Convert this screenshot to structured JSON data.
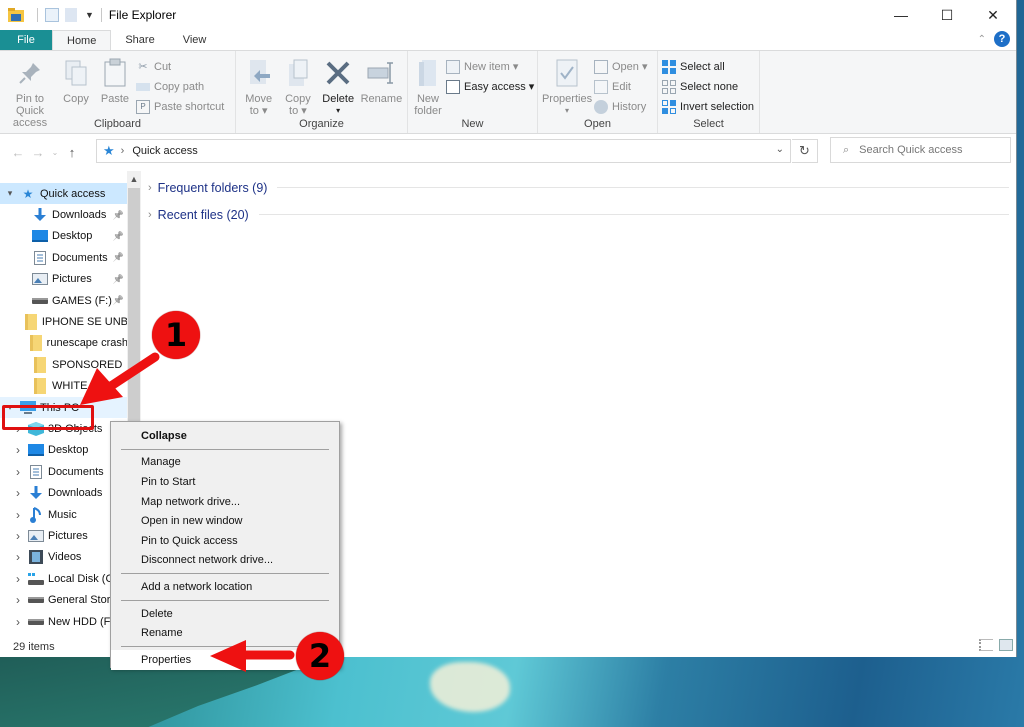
{
  "window": {
    "title": "File Explorer",
    "controls": {
      "minimize": "—",
      "maximize": "☐",
      "close": "✕"
    }
  },
  "tabs": [
    {
      "label": "File",
      "active": false
    },
    {
      "label": "Home",
      "active": true
    },
    {
      "label": "Share",
      "active": false
    },
    {
      "label": "View",
      "active": false
    }
  ],
  "ribbon": {
    "clipboard": {
      "label": "Clipboard",
      "pin": "Pin to Quick access",
      "pin_line1": "Pin to Quick",
      "pin_line2": "access",
      "copy": "Copy",
      "paste": "Paste",
      "cut": "Cut",
      "copy_path": "Copy path",
      "paste_shortcut": "Paste shortcut"
    },
    "organize": {
      "label": "Organize",
      "move_line1": "Move",
      "move_line2": "to ▾",
      "copy_line1": "Copy",
      "copy_line2": "to ▾",
      "delete": "Delete",
      "delete_dd": "▾",
      "rename": "Rename"
    },
    "new": {
      "label": "New",
      "new_folder_line1": "New",
      "new_folder_line2": "folder",
      "new_item": "New item ▾",
      "easy_access": "Easy access ▾"
    },
    "open": {
      "label": "Open",
      "properties": "Properties",
      "properties_dd": "▾",
      "open": "Open ▾",
      "edit": "Edit",
      "history": "History"
    },
    "select": {
      "label": "Select",
      "select_all": "Select all",
      "select_none": "Select none",
      "invert": "Invert selection"
    }
  },
  "navigation": {
    "address_path": "Quick access",
    "address_separator": "›",
    "search_placeholder": "Search Quick access"
  },
  "sidebar": {
    "quick_access": {
      "label": "Quick access"
    },
    "quick_items": [
      {
        "label": "Downloads",
        "icon": "download-arrow",
        "pinned": true
      },
      {
        "label": "Desktop",
        "icon": "desktop",
        "pinned": true
      },
      {
        "label": "Documents",
        "icon": "document",
        "pinned": true
      },
      {
        "label": "Pictures",
        "icon": "pictures",
        "pinned": true
      },
      {
        "label": "GAMES (F:)",
        "icon": "drive",
        "pinned": true
      },
      {
        "label": "IPHONE SE UNB",
        "icon": "folder",
        "pinned": false
      },
      {
        "label": "runescape crash",
        "icon": "folder",
        "pinned": false
      },
      {
        "label": "SPONSORED",
        "icon": "folder",
        "pinned": false
      },
      {
        "label": "WHITE PHO",
        "icon": "folder",
        "pinned": false
      }
    ],
    "this_pc": {
      "label": "This PC"
    },
    "pc_items": [
      {
        "label": "3D Objects",
        "icon": "3d-objects"
      },
      {
        "label": "Desktop",
        "icon": "desktop"
      },
      {
        "label": "Documents",
        "icon": "document"
      },
      {
        "label": "Downloads",
        "icon": "download-arrow"
      },
      {
        "label": "Music",
        "icon": "music"
      },
      {
        "label": "Pictures",
        "icon": "pictures"
      },
      {
        "label": "Videos",
        "icon": "videos"
      },
      {
        "label": "Local Disk (C",
        "icon": "system-drive"
      },
      {
        "label": "General Stora",
        "icon": "drive"
      },
      {
        "label": "New HDD (F:",
        "icon": "drive"
      }
    ]
  },
  "main": {
    "groups": [
      {
        "label": "Frequent folders (9)"
      },
      {
        "label": "Recent files (20)"
      }
    ]
  },
  "status": {
    "items": "29 items"
  },
  "context_menu": {
    "items": [
      {
        "label": "Collapse",
        "bold": true
      },
      {
        "separator": true
      },
      {
        "label": "Manage"
      },
      {
        "label": "Pin to Start"
      },
      {
        "label": "Map network drive..."
      },
      {
        "label": "Open in new window"
      },
      {
        "label": "Pin to Quick access"
      },
      {
        "label": "Disconnect network drive..."
      },
      {
        "separator": true
      },
      {
        "label": "Add a network location"
      },
      {
        "separator": true
      },
      {
        "label": "Delete"
      },
      {
        "label": "Rename"
      },
      {
        "separator": true
      },
      {
        "label": "Properties",
        "highlighted": true
      }
    ]
  },
  "annotations": {
    "step1": "1",
    "step2": "2",
    "color": "#ee1111"
  }
}
